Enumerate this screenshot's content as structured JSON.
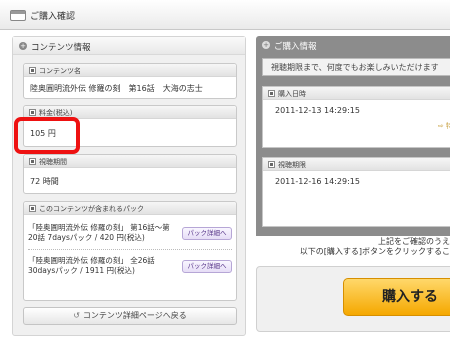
{
  "window": {
    "title": "ご購入確認"
  },
  "left": {
    "header": "コンテンツ情報",
    "content_name": {
      "label": "コンテンツ名",
      "value": "陸奥圓明流外伝 修羅の刻　第16話　大海の志士"
    },
    "price": {
      "label": "料金(税込)",
      "value": "105 円"
    },
    "period": {
      "label": "視聴期間",
      "value": "72 時間"
    },
    "packs": {
      "label": "このコンテンツが含まれるパック",
      "items": [
        {
          "text": "「陸奥圓明流外伝 修羅の刻」 第16話～第20話 7daysパック / 420 円(税込)",
          "button": "パック詳細へ"
        },
        {
          "text": "「陸奥圓明流外伝 修羅の刻」 全26話 30daysパック / 1911 円(税込)",
          "button": "パック詳細へ"
        }
      ]
    },
    "back_button": "コンテンツ詳細ページへ戻る"
  },
  "right": {
    "header": "ご購入情報",
    "notice": "視聴期限まで、何度でもお楽しみいただけます",
    "purchase_date": {
      "label": "購入日時",
      "value": "2011-12-13 14:29:15"
    },
    "expiry": {
      "label": "視聴期限",
      "value": "2011-12-16 14:29:15"
    },
    "side_link": "特",
    "confirm_line1": "上記をご確認のうえ",
    "confirm_line2": "以下の[購入する]ボタンをクリックするこ",
    "buy_button": "購入する"
  },
  "colors": {
    "highlight": "#ee1111",
    "buy_button": "#f5a800"
  }
}
